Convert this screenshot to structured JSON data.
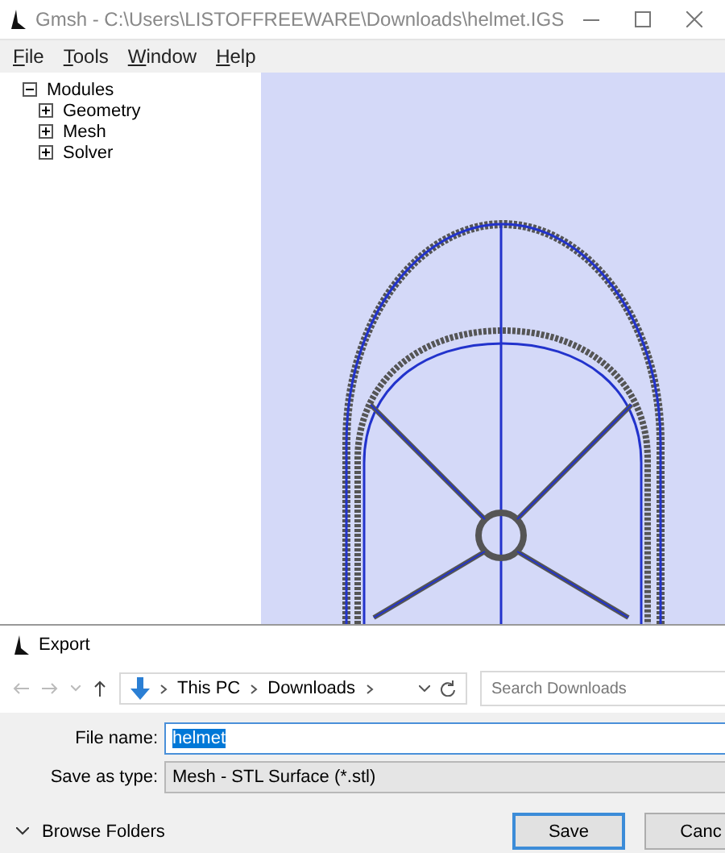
{
  "window": {
    "title": "Gmsh - C:\\Users\\LISTOFFREEWARE\\Downloads\\helmet.IGS"
  },
  "menu": [
    "File",
    "Tools",
    "Window",
    "Help"
  ],
  "tree": [
    {
      "label": "Modules",
      "expanded": true,
      "children": [
        {
          "label": "Geometry",
          "expanded": false
        },
        {
          "label": "Mesh",
          "expanded": false
        },
        {
          "label": "Solver",
          "expanded": false
        }
      ]
    }
  ],
  "dialog": {
    "title": "Export",
    "breadcrumb": [
      "This PC",
      "Downloads"
    ],
    "search": {
      "placeholder": "Search Downloads"
    },
    "file_name": {
      "label": "File name:",
      "value": "helmet"
    },
    "save_as_type": {
      "label": "Save as type:",
      "value": "Mesh - STL Surface (*.stl)"
    },
    "browse_folders": "Browse Folders",
    "buttons": [
      {
        "label": "Save",
        "default": true
      },
      {
        "label": "Canc",
        "default": false
      }
    ]
  }
}
